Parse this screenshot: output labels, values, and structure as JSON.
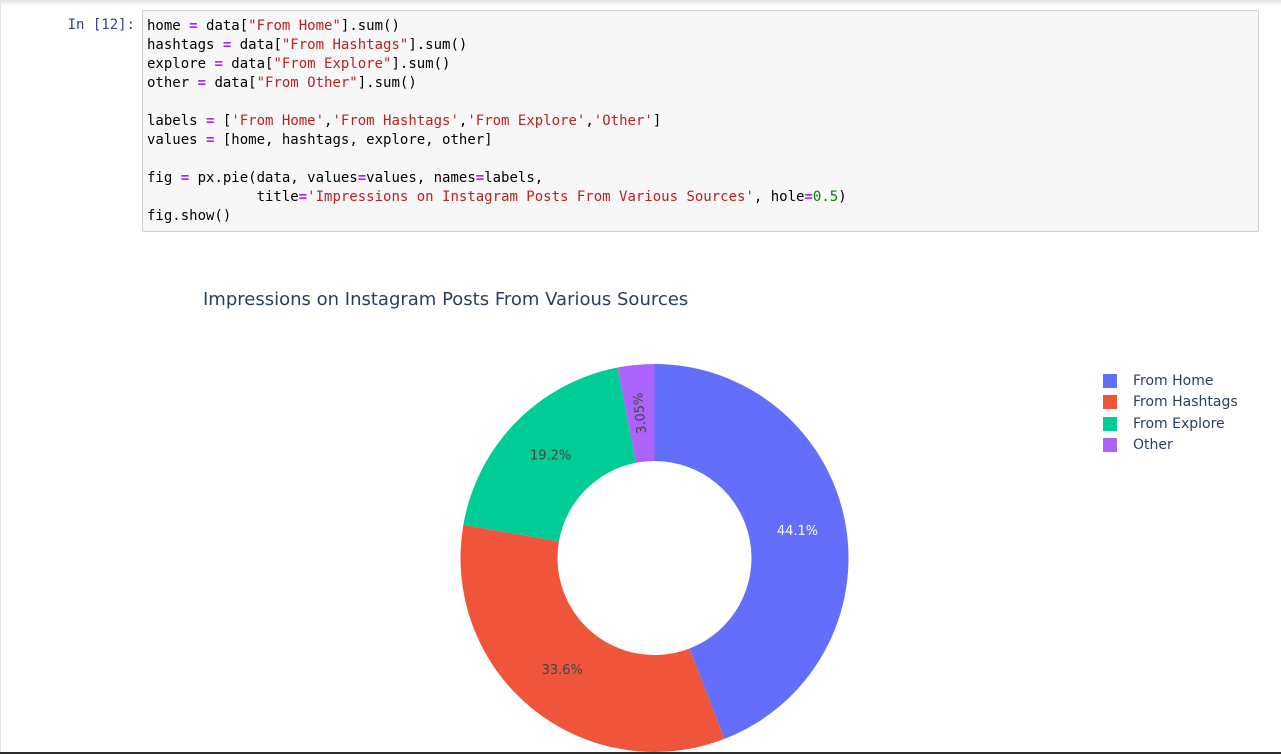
{
  "cell": {
    "prompt": "In [12]:",
    "code_lines": [
      [
        {
          "t": "home "
        },
        {
          "t": "=",
          "c": "op"
        },
        {
          "t": " data["
        },
        {
          "t": "\"From Home\"",
          "c": "str"
        },
        {
          "t": "].sum()"
        }
      ],
      [
        {
          "t": "hashtags "
        },
        {
          "t": "=",
          "c": "op"
        },
        {
          "t": " data["
        },
        {
          "t": "\"From Hashtags\"",
          "c": "str"
        },
        {
          "t": "].sum()"
        }
      ],
      [
        {
          "t": "explore "
        },
        {
          "t": "=",
          "c": "op"
        },
        {
          "t": " data["
        },
        {
          "t": "\"From Explore\"",
          "c": "str"
        },
        {
          "t": "].sum()"
        }
      ],
      [
        {
          "t": "other "
        },
        {
          "t": "=",
          "c": "op"
        },
        {
          "t": " data["
        },
        {
          "t": "\"From Other\"",
          "c": "str"
        },
        {
          "t": "].sum()"
        }
      ],
      [],
      [
        {
          "t": "labels "
        },
        {
          "t": "=",
          "c": "op"
        },
        {
          "t": " ["
        },
        {
          "t": "'From Home'",
          "c": "str"
        },
        {
          "t": ","
        },
        {
          "t": "'From Hashtags'",
          "c": "str"
        },
        {
          "t": ","
        },
        {
          "t": "'From Explore'",
          "c": "str"
        },
        {
          "t": ","
        },
        {
          "t": "'Other'",
          "c": "str"
        },
        {
          "t": "]"
        }
      ],
      [
        {
          "t": "values "
        },
        {
          "t": "=",
          "c": "op"
        },
        {
          "t": " [home, hashtags, explore, other]"
        }
      ],
      [],
      [
        {
          "t": "fig "
        },
        {
          "t": "=",
          "c": "op"
        },
        {
          "t": " px.pie(data, values"
        },
        {
          "t": "=",
          "c": "op"
        },
        {
          "t": "values, names"
        },
        {
          "t": "=",
          "c": "op"
        },
        {
          "t": "labels,"
        }
      ],
      [
        {
          "t": "             title"
        },
        {
          "t": "=",
          "c": "op"
        },
        {
          "t": "'Impressions on Instagram Posts From Various Sources'",
          "c": "str"
        },
        {
          "t": ", hole"
        },
        {
          "t": "=",
          "c": "op"
        },
        {
          "t": "0.5",
          "c": "num"
        },
        {
          "t": ")"
        }
      ],
      [
        {
          "t": "fig.show()"
        }
      ]
    ]
  },
  "colors": {
    "keyword_operator": "#aa22ff",
    "string": "#ba2121",
    "number": "#008000",
    "prompt": "#303f9f",
    "chart_text": "#2a3f5f"
  },
  "chart_data": {
    "type": "pie",
    "title": "Impressions on Instagram Posts From Various Sources",
    "hole": 0.5,
    "legend_position": "top-right",
    "series": [
      {
        "name": "From Home",
        "percent": 44.1,
        "label": "44.1%",
        "color": "#636efa",
        "label_color": "#ffffff"
      },
      {
        "name": "From Hashtags",
        "percent": 33.6,
        "label": "33.6%",
        "color": "#ef553b",
        "label_color": "#444444"
      },
      {
        "name": "From Explore",
        "percent": 19.2,
        "label": "19.2%",
        "color": "#00cc96",
        "label_color": "#444444"
      },
      {
        "name": "Other",
        "percent": 3.05,
        "label": "3.05%",
        "color": "#ab63fa",
        "label_color": "#444444"
      }
    ]
  }
}
